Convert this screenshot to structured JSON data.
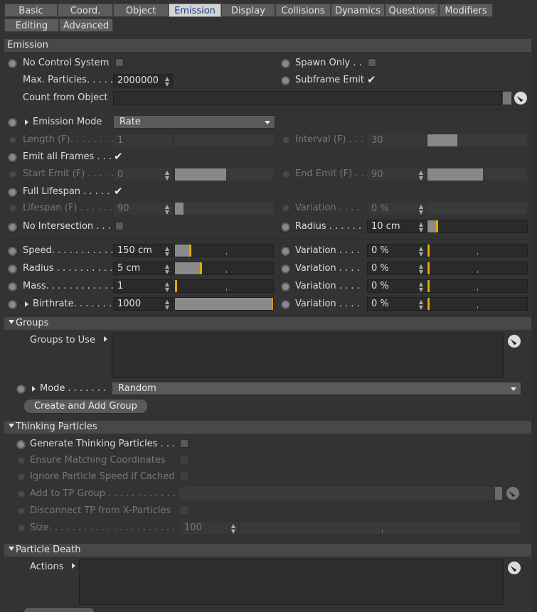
{
  "tabs_row1": [
    "Basic",
    "Coord.",
    "Object",
    "Emission",
    "Display",
    "Collisions",
    "Dynamics",
    "Questions",
    "Modifiers"
  ],
  "tabs_row2": [
    "Editing",
    "Advanced"
  ],
  "active_tab": "Emission",
  "emission": {
    "title": "Emission",
    "no_control_system": "No Control System",
    "spawn_only": "Spawn Only . .",
    "max_particles_label": "Max. Particles. . . . .",
    "max_particles_value": "2000000",
    "subframe_emit": "Subframe Emit",
    "count_from_object": "Count from Object",
    "emission_mode_label": "Emission Mode",
    "emission_mode_value": "Rate",
    "length_label": "Length (F). . . . . . . .",
    "length_value": "1",
    "interval_label": "Interval (F) . . .",
    "interval_value": "30",
    "emit_all_frames": "Emit all Frames . . .",
    "start_emit_label": "Start Emit (F) . . . . .",
    "start_emit_value": "0",
    "end_emit_label": "End Emit (F) . . .",
    "end_emit_value": "90",
    "full_lifespan": "Full Lifespan . . . . .",
    "lifespan_label": "Lifespan (F) . . . . . .",
    "lifespan_value": "90",
    "lifespan_variation_label": "Variation . . . .",
    "lifespan_variation_value": "0 %",
    "no_intersection": "No Intersection . . .",
    "radius_label": "Radius . . . . . .",
    "radius_value": "10 cm",
    "speed_label": "Speed. . . . . . . . . . .",
    "speed_value": "150 cm",
    "radius2_label": "Radius . . . . . . . . . .",
    "radius2_value": "5 cm",
    "mass_label": "Mass. . . . . . . . . . . .",
    "mass_value": "1",
    "birthrate_label": "Birthrate. . . . . . . .",
    "birthrate_value": "1000",
    "variation_label": "Variation . . . .",
    "variation_values": [
      "0 %",
      "0 %",
      "0 %",
      "0 %"
    ]
  },
  "groups": {
    "title": "Groups",
    "groups_to_use": "Groups to Use",
    "mode_label": "Mode . . . . . . .",
    "mode_value": "Random",
    "create_button": "Create and Add Group"
  },
  "thinking": {
    "title": "Thinking Particles",
    "generate": "Generate Thinking Particles . . .",
    "ensure": "Ensure Matching Coordinates",
    "ignore": "Ignore Particle Speed if Cached",
    "add_to_group": "Add to TP Group . . . . . . . . . . . .",
    "disconnect": "Disconnect TP from X-Particles",
    "size_label": "Size. . . . . . . . . . . . . . . . . . . . . .",
    "size_value": "100"
  },
  "death": {
    "title": "Particle Death",
    "actions": "Actions"
  }
}
